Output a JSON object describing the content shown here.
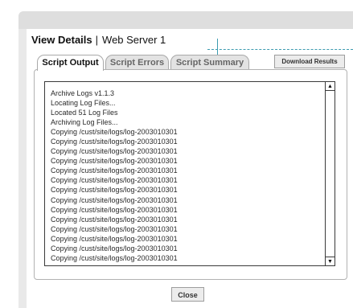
{
  "dialog": {
    "title": "View Details",
    "separator": "|",
    "subtitle": "Web Server 1"
  },
  "tabs": [
    {
      "label": "Script Output",
      "active": true
    },
    {
      "label": "Script Errors",
      "active": false
    },
    {
      "label": "Script Summary",
      "active": false
    }
  ],
  "download_label": "Download Results",
  "log": {
    "lines": [
      "Archive Logs v1.1.3",
      "Locating Log Files...",
      "Located 51 Log Files",
      "Archiving Log Files...",
      "Copying /cust/site/logs/log-2003010301",
      "Copying /cust/site/logs/log-2003010301",
      "Copying /cust/site/logs/log-2003010301",
      "Copying /cust/site/logs/log-2003010301",
      "Copying /cust/site/logs/log-2003010301",
      "Copying /cust/site/logs/log-2003010301",
      "Copying /cust/site/logs/log-2003010301",
      "Copying /cust/site/logs/log-2003010301",
      "Copying /cust/site/logs/log-2003010301",
      "Copying /cust/site/logs/log-2003010301",
      "Copying /cust/site/logs/log-2003010301",
      "Copying /cust/site/logs/log-2003010301",
      "Copying /cust/site/logs/log-2003010301",
      "Copying /cust/site/logs/log-2003010301"
    ],
    "scroll_up_icon": "triangle-up",
    "scroll_down_icon": "triangle-down"
  },
  "close_label": "Close",
  "colors": {
    "annotation": "#3c9bb0",
    "window_bg": "#e9e9e9",
    "titlebar_bg": "#dedede"
  }
}
